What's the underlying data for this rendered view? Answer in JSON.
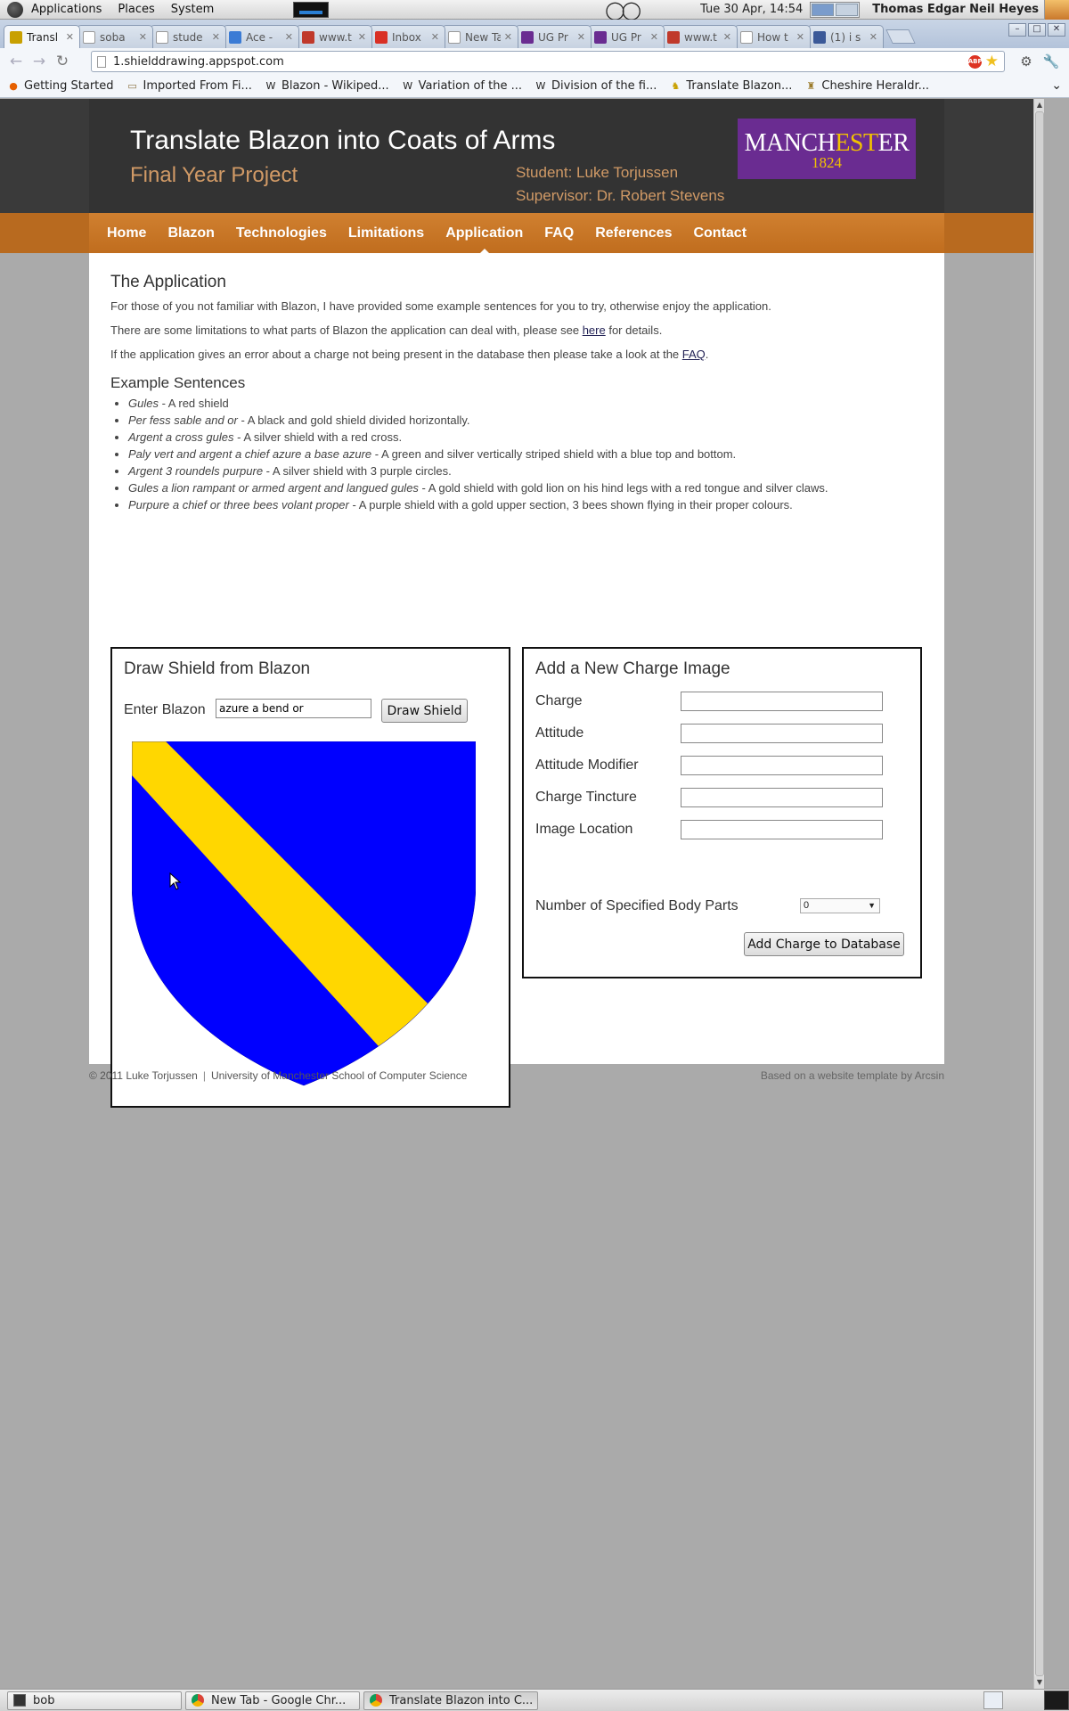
{
  "gnome_panel": {
    "menus": [
      "Applications",
      "Places",
      "System"
    ],
    "clock": "Tue 30 Apr, 14:54",
    "user": "Thomas Edgar Neil Heyes"
  },
  "browser": {
    "tabs": [
      {
        "label": "Transl",
        "icon_color": "#c8a000",
        "icon": "lion-icon",
        "active": true
      },
      {
        "label": "soba",
        "icon_color": "#ffffff",
        "icon": "page-icon"
      },
      {
        "label": "stude",
        "icon_color": "#ffffff",
        "icon": "page-icon"
      },
      {
        "label": "Ace -",
        "icon_color": "#3a7bd5",
        "icon": "cloud-icon"
      },
      {
        "label": "www.t",
        "icon_color": "#c0392b",
        "icon": "flag-icon"
      },
      {
        "label": "Inbox",
        "icon_color": "#d93025",
        "icon": "gmail-icon"
      },
      {
        "label": "New Tab",
        "icon_color": "#ffffff",
        "icon": "blank-icon"
      },
      {
        "label": "UG Pr",
        "icon_color": "#6a2c91",
        "icon": "m-icon"
      },
      {
        "label": "UG Pr",
        "icon_color": "#6a2c91",
        "icon": "m-icon"
      },
      {
        "label": "www.t",
        "icon_color": "#c0392b",
        "icon": "flag-icon"
      },
      {
        "label": "How t",
        "icon_color": "#ffffff",
        "icon": "face-icon"
      },
      {
        "label": "(1) i s",
        "icon_color": "#3b5998",
        "icon": "facebook-icon"
      }
    ],
    "url": "1.shielddrawing.appspot.com",
    "bookmarks": [
      {
        "label": "Getting Started",
        "icon": "firefox-icon"
      },
      {
        "label": "Imported From Fi...",
        "icon": "folder-icon"
      },
      {
        "label": "Blazon - Wikiped...",
        "icon": "wikipedia-icon"
      },
      {
        "label": "Variation of the ...",
        "icon": "wikipedia-icon"
      },
      {
        "label": "Division of the fi...",
        "icon": "wikipedia-icon"
      },
      {
        "label": "Translate Blazon...",
        "icon": "lion-icon"
      },
      {
        "label": "Cheshire Heraldr...",
        "icon": "crest-icon"
      }
    ]
  },
  "site": {
    "title": "Translate Blazon into Coats of Arms",
    "subtitle": "Final Year Project",
    "student": "Student: Luke Torjussen",
    "supervisor": "Supervisor: Dr. Robert Stevens",
    "logo_word_a": "MANCH",
    "logo_word_b": "EST",
    "logo_word_c": "ER",
    "logo_year": "1824",
    "nav": [
      "Home",
      "Blazon",
      "Technologies",
      "Limitations",
      "Application",
      "FAQ",
      "References",
      "Contact"
    ],
    "nav_current": "Application"
  },
  "content": {
    "heading": "The Application",
    "intro": "For those of you not familiar with Blazon, I have provided some example sentences for you to try, otherwise enjoy the application.",
    "limits_pre": "There are some limitations to what parts of Blazon the application can deal with, please see ",
    "limits_link": "here",
    "limits_post": " for details.",
    "error_pre": "If the application gives an error about a charge not being present in the database then please take a look at the ",
    "error_link": "FAQ",
    "error_post": ".",
    "examples_heading": "Example Sentences",
    "examples": [
      {
        "blazon": "Gules",
        "desc": " - A red shield"
      },
      {
        "blazon": "Per fess sable and or",
        "desc": " - A black and gold shield divided horizontally."
      },
      {
        "blazon": "Argent a cross gules",
        "desc": " - A silver shield with a red cross."
      },
      {
        "blazon": "Paly vert and argent a chief azure a base azure",
        "desc": " - A green and silver vertically striped shield with a blue top and bottom."
      },
      {
        "blazon": "Argent 3 roundels purpure",
        "desc": " - A silver shield with 3 purple circles."
      },
      {
        "blazon": "Gules a lion rampant or armed argent and langued gules",
        "desc": " - A gold shield with gold lion on his hind legs with a red tongue and silver claws."
      },
      {
        "blazon": "Purpure a chief or three bees volant proper",
        "desc": " - A purple shield with a gold upper section, 3 bees shown flying in their proper colours."
      }
    ]
  },
  "draw_panel": {
    "heading": "Draw Shield from Blazon",
    "label": "Enter Blazon",
    "value": "azure a bend or",
    "button": "Draw Shield",
    "field_color": "#0000ff",
    "bend_color": "#ffd700"
  },
  "charge_panel": {
    "heading": "Add a New Charge Image",
    "fields": [
      "Charge",
      "Attitude",
      "Attitude Modifier",
      "Charge Tincture",
      "Image Location"
    ],
    "body_parts_label": "Number of Specified Body Parts",
    "body_parts_value": "0",
    "button": "Add Charge to Database"
  },
  "footer": {
    "copyright": "© 2011 Luke Torjussen",
    "university": "University of Manchester School of Computer Science",
    "credit": "Based on a website template by Arcsin"
  },
  "taskbar": {
    "items": [
      {
        "label": "bob",
        "icon": "terminal-icon"
      },
      {
        "label": "New Tab - Google Chr...",
        "icon": "chrome-icon"
      },
      {
        "label": "Translate Blazon into C...",
        "icon": "chrome-icon"
      }
    ]
  }
}
